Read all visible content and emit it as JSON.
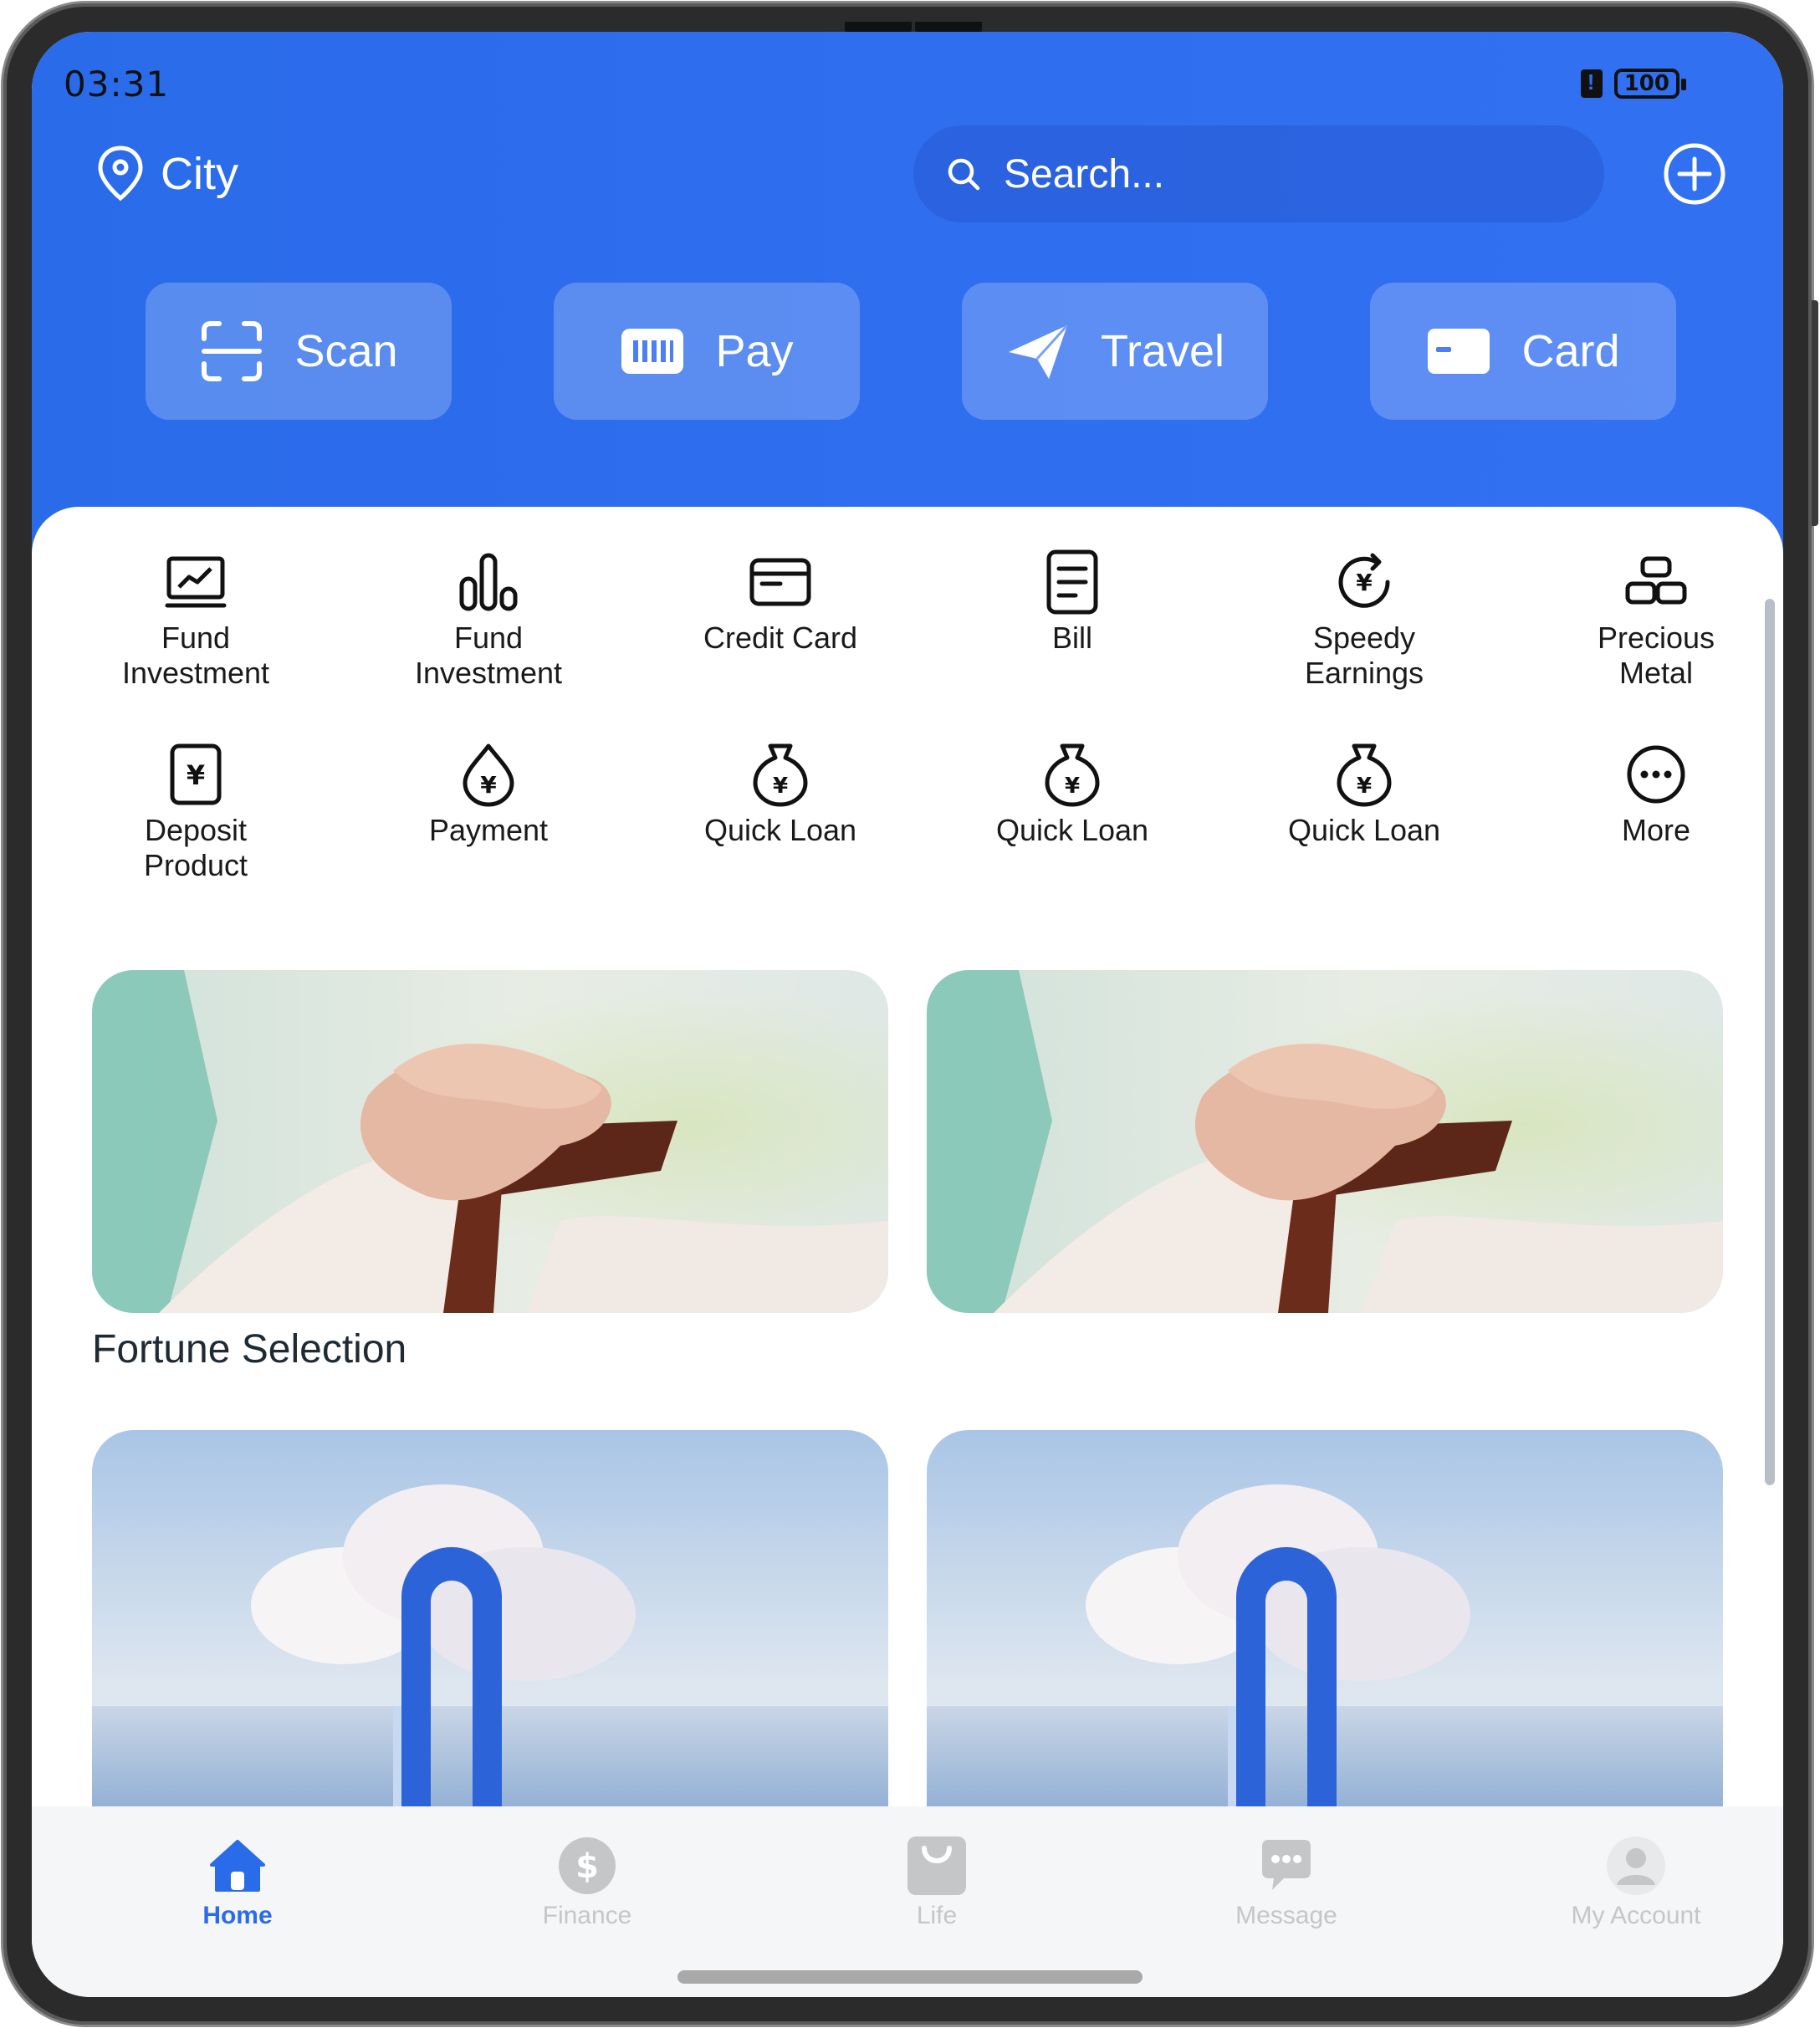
{
  "status_bar": {
    "time": "03:31",
    "battery": "100"
  },
  "header": {
    "location": "City",
    "search_placeholder": "Search...",
    "quick_actions": [
      {
        "label": "Scan",
        "icon": "scan-icon"
      },
      {
        "label": "Pay",
        "icon": "barcode-icon"
      },
      {
        "label": "Travel",
        "icon": "paper-plane-icon"
      },
      {
        "label": "Card",
        "icon": "card-icon"
      }
    ]
  },
  "services": [
    {
      "label": "Fund\nInvestment",
      "icon": "trend-chart-icon"
    },
    {
      "label": "Fund\nInvestment",
      "icon": "bar-chart-icon"
    },
    {
      "label": "Credit Card",
      "icon": "credit-card-icon"
    },
    {
      "label": "Bill",
      "icon": "bill-icon"
    },
    {
      "label": "Speedy\nEarnings",
      "icon": "yen-cycle-icon"
    },
    {
      "label": "Precious\nMetal",
      "icon": "gold-bars-icon"
    },
    {
      "label": "Deposit\nProduct",
      "icon": "yen-document-icon"
    },
    {
      "label": "Payment",
      "icon": "yen-drop-icon"
    },
    {
      "label": "Quick Loan",
      "icon": "money-bag-icon"
    },
    {
      "label": "Quick Loan",
      "icon": "money-bag-icon"
    },
    {
      "label": "Quick Loan",
      "icon": "money-bag-icon"
    },
    {
      "label": "More",
      "icon": "more-icon"
    }
  ],
  "section_title": "Fortune Selection",
  "tabbar": {
    "items": [
      {
        "label": "Home",
        "icon": "home-icon",
        "active": true
      },
      {
        "label": "Finance",
        "icon": "dollar-icon",
        "active": false
      },
      {
        "label": "Life",
        "icon": "bag-icon",
        "active": false
      },
      {
        "label": "Message",
        "icon": "chat-icon",
        "active": false
      },
      {
        "label": "My Account",
        "icon": "person-icon",
        "active": false
      }
    ]
  },
  "colors": {
    "brand_blue": "#2a6bea",
    "tab_inactive": "#c4c6c8",
    "text_dark": "#1a1a1a"
  }
}
